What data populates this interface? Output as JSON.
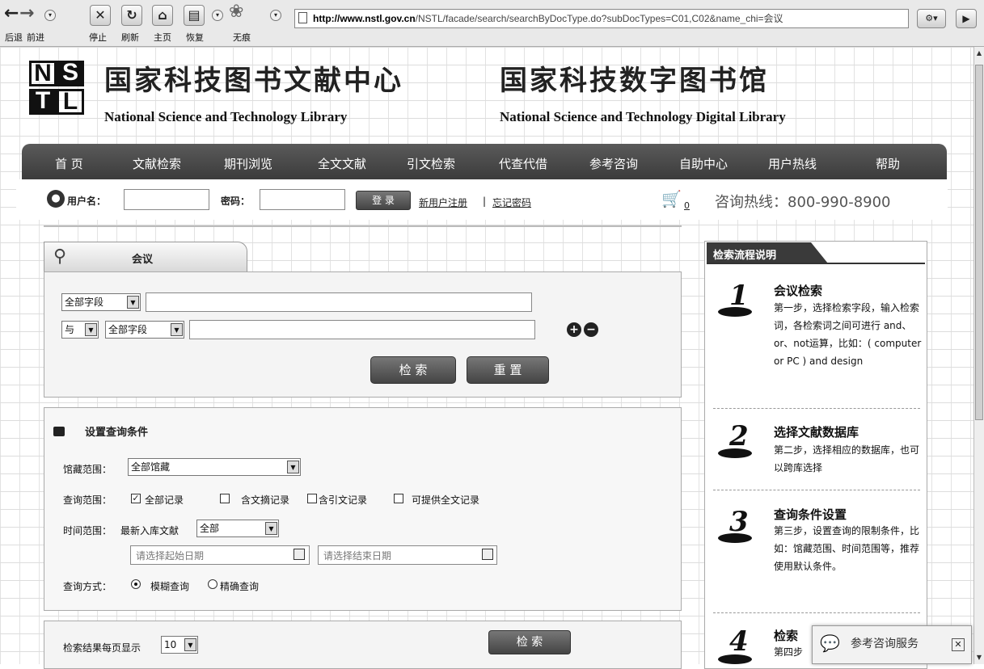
{
  "browser": {
    "toolbar_labels": {
      "back": "后退",
      "forward": "前进",
      "stop": "停止",
      "refresh": "刷新",
      "home": "主页",
      "restore": "恢复",
      "incognito": "无痕"
    },
    "url_host": "http://www.nstl.gov.cn",
    "url_path": "/NSTL/facade/search/searchByDocType.do?subDocTypes=C01,C02&name_chi=会议"
  },
  "header": {
    "logo_letters": [
      "N",
      "S",
      "T",
      "L"
    ],
    "title_cn_left": "国家科技图书文献中心",
    "title_en_left": "National Science and Technology Library",
    "title_cn_right": "国家科技数字图书馆",
    "title_en_right": "National Science and Technology Digital Library"
  },
  "nav": [
    "首 页",
    "文献检索",
    "期刊浏览",
    "全文文献",
    "引文检索",
    "代查代借",
    "参考咨询",
    "自助中心",
    "用户热线",
    "帮助"
  ],
  "login": {
    "username_label": "用户名：",
    "password_label": "密码：",
    "login_button": "登 录",
    "register_link": "新用户注册",
    "separator": "|",
    "forgot_link": "忘记密码",
    "cart_count": "0",
    "hotline": "咨询热线：800-990-8900"
  },
  "search": {
    "tab_label": "会议",
    "row1_field": "全部字段",
    "row2_operator": "与",
    "row2_field": "全部字段",
    "search_button": "检 索",
    "reset_button": "重 置"
  },
  "conditions": {
    "title": "设置查询条件",
    "library_label": "馆藏范围：",
    "library_value": "全部馆藏",
    "scope_label": "查询范围：",
    "scope_options": [
      {
        "label": "全部记录",
        "checked": true
      },
      {
        "label": "含文摘记录",
        "checked": false
      },
      {
        "label": "含引文记录",
        "checked": false
      },
      {
        "label": "可提供全文记录",
        "checked": false
      }
    ],
    "time_label": "时间范围：",
    "time_prefix": "最新入库文献",
    "time_value": "全部",
    "start_date_placeholder": "请选择起始日期",
    "end_date_placeholder": "请选择结束日期",
    "mode_label": "查询方式：",
    "mode_options": [
      {
        "label": "模糊查询",
        "selected": true
      },
      {
        "label": "精确查询",
        "selected": false
      }
    ]
  },
  "results": {
    "per_page_label": "检索结果每页显示",
    "per_page_value": "10",
    "search_button": "检 索"
  },
  "guide": {
    "title": "检索流程说明",
    "steps": [
      {
        "num": "1",
        "title": "会议检索",
        "desc": "第一步，选择检索字段，输入检索词，各检索词之间可进行 and、or、not运算，比如：( computer or PC ) and design"
      },
      {
        "num": "2",
        "title": "选择文献数据库",
        "desc": "第二步，选择相应的数据库，也可以跨库选择"
      },
      {
        "num": "3",
        "title": "查询条件设置",
        "desc": "第三步，设置查询的限制条件，比如：馆藏范围、时间范围等，推荐使用默认条件。"
      },
      {
        "num": "4",
        "title": "检索",
        "desc": "第四步"
      }
    ]
  },
  "chat": {
    "label": "参考咨询服务",
    "close": "✕"
  }
}
